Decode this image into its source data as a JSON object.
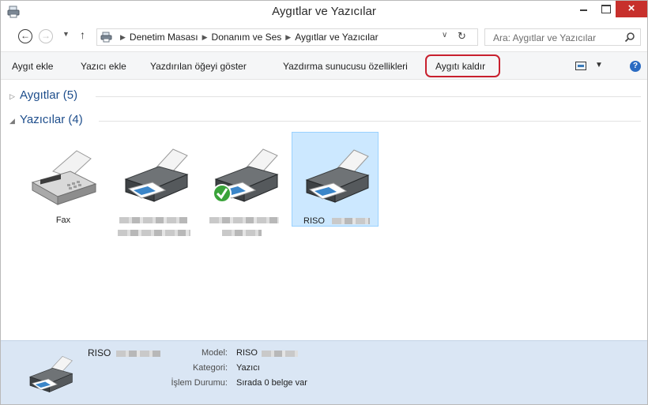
{
  "window": {
    "title": "Aygıtlar ve Yazıcılar",
    "close_glyph": "×"
  },
  "address": {
    "breadcrumbs": [
      "Denetim Masası",
      "Donanım ve Ses",
      "Aygıtlar ve Yazıcılar"
    ],
    "search_placeholder": "Ara: Aygıtlar ve Yazıcılar"
  },
  "toolbar": {
    "items": [
      "Aygıt ekle",
      "Yazıcı ekle",
      "Yazdırılan öğeyi göster",
      "Yazdırma sunucusu özellikleri",
      "Aygıtı kaldır"
    ],
    "highlighted": "Aygıtı kaldır",
    "highlight_color": "#c8202e"
  },
  "groups": {
    "devices": {
      "label": "Aygıtlar (5)",
      "collapsed": true
    },
    "printers": {
      "label": "Yazıcılar (4)",
      "collapsed": false
    }
  },
  "printers": [
    {
      "name": "Fax",
      "icon": "fax-icon",
      "blurred": false,
      "default": false,
      "selected": false
    },
    {
      "name": "",
      "icon": "printer-icon",
      "blurred": true,
      "default": false,
      "selected": false
    },
    {
      "name": "",
      "icon": "printer-icon",
      "blurred": true,
      "default": true,
      "selected": false
    },
    {
      "name": "RISO",
      "icon": "printer-icon",
      "blurred": true,
      "default": false,
      "selected": true
    }
  ],
  "details": {
    "title": "RISO",
    "rows": [
      {
        "key": "Model:",
        "value": "RISO"
      },
      {
        "key": "Kategori:",
        "value": "Yazıcı"
      },
      {
        "key": "İşlem Durumu:",
        "value": "Sırada 0 belge var"
      }
    ]
  },
  "colors": {
    "group_header": "#1e4e8c",
    "selection_bg": "#cce8ff",
    "details_bg": "#dae6f4",
    "close_button": "#c7302c"
  }
}
